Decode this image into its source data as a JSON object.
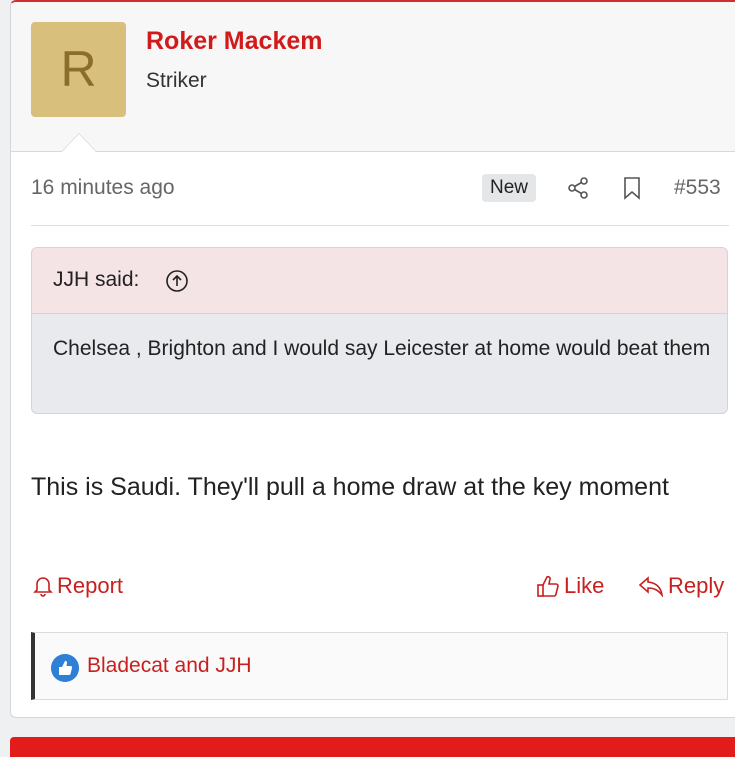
{
  "user": {
    "avatar_letter": "R",
    "name": "Roker Mackem",
    "title": "Striker"
  },
  "meta": {
    "timestamp": "16 minutes ago",
    "badge": "New",
    "post_number": "#553"
  },
  "quote": {
    "author": "JJH said:",
    "text": "Chelsea , Brighton and I would say Leicester at home would beat them"
  },
  "post": {
    "body": "This is Saudi. They'll pull a home draw at the key moment"
  },
  "actions": {
    "report": "Report",
    "like": "Like",
    "reply": "Reply"
  },
  "reactions": {
    "text": "Bladecat and JJH"
  },
  "colors": {
    "accent": "#d11a1a",
    "avatar_bg": "#d8bf7c",
    "like_blue": "#2f7fd6"
  },
  "icons": [
    "share-icon",
    "bookmark-icon",
    "arrow-up-circle-icon",
    "bell-icon",
    "thumbs-up-icon",
    "reply-icon",
    "like-reaction-icon"
  ]
}
